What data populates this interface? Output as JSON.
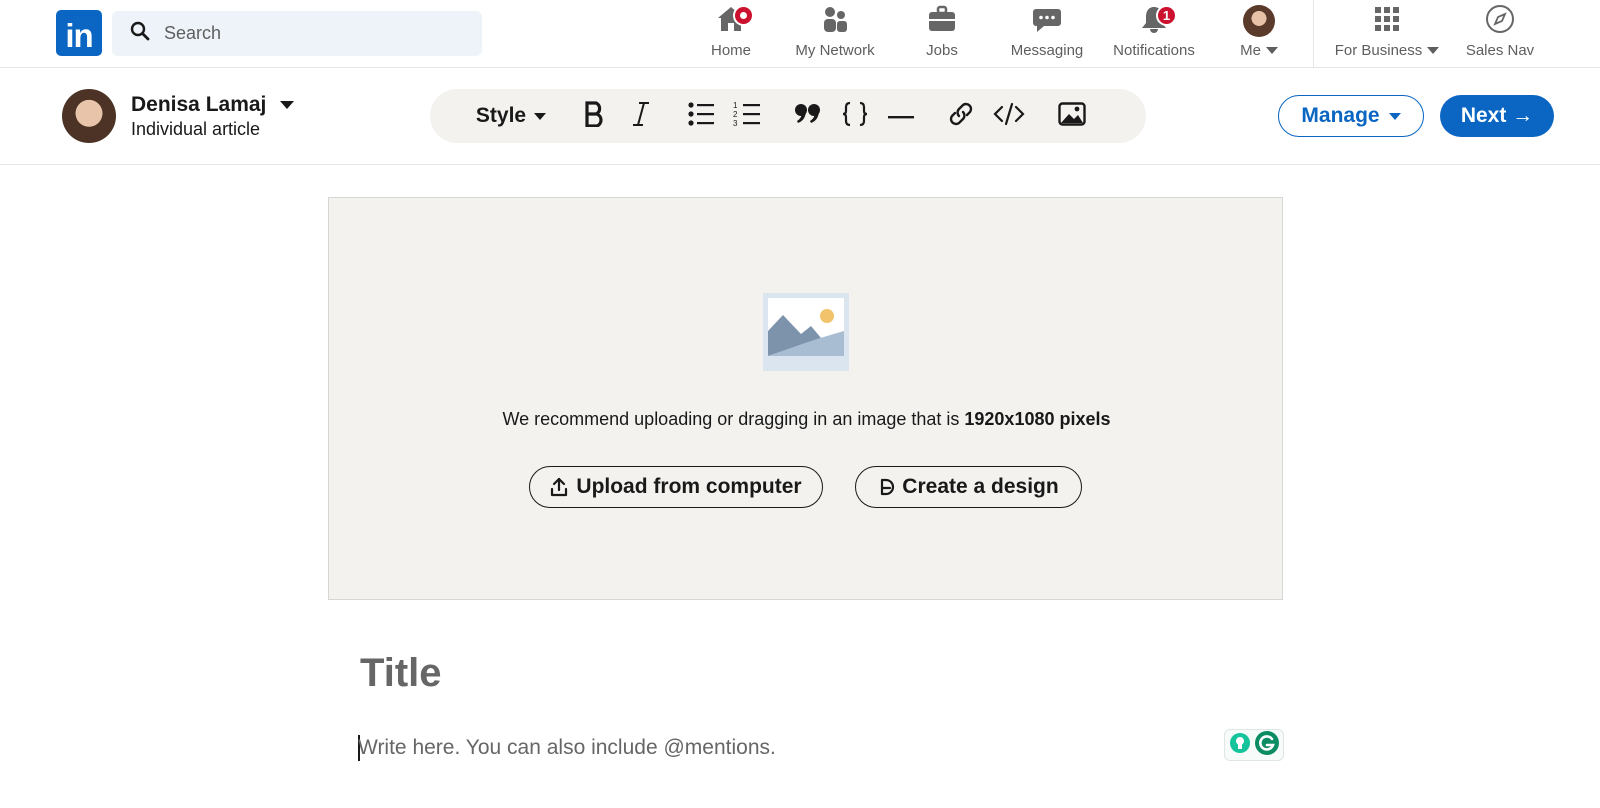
{
  "nav": {
    "logo_text": "in",
    "search_placeholder": "Search",
    "items": [
      {
        "label": "Home",
        "icon": "home-icon"
      },
      {
        "label": "My Network",
        "icon": "people-icon"
      },
      {
        "label": "Jobs",
        "icon": "briefcase-icon"
      },
      {
        "label": "Messaging",
        "icon": "chat-icon"
      },
      {
        "label": "Notifications",
        "icon": "bell-icon",
        "badge": "1"
      },
      {
        "label": "Me",
        "icon": "avatar"
      },
      {
        "label": "For Business",
        "icon": "grid-icon"
      },
      {
        "label": "Sales Nav",
        "icon": "compass-icon"
      }
    ]
  },
  "editor": {
    "author_name": "Denisa Lamaj",
    "author_sub": "Individual article",
    "style_label": "Style",
    "manage_label": "Manage",
    "next_label": "Next →"
  },
  "cover": {
    "recommend_text": "We recommend uploading or dragging in an image that is ",
    "recommend_size": "1920x1080 pixels",
    "upload_label": "Upload from computer",
    "design_label": "Create a design"
  },
  "article": {
    "title_placeholder": "Title",
    "body_placeholder": "Write here. You can also include @mentions."
  },
  "colors": {
    "brand": "#0a66c2",
    "badge": "#cb112d",
    "cover_bg": "#f3f2ef"
  }
}
